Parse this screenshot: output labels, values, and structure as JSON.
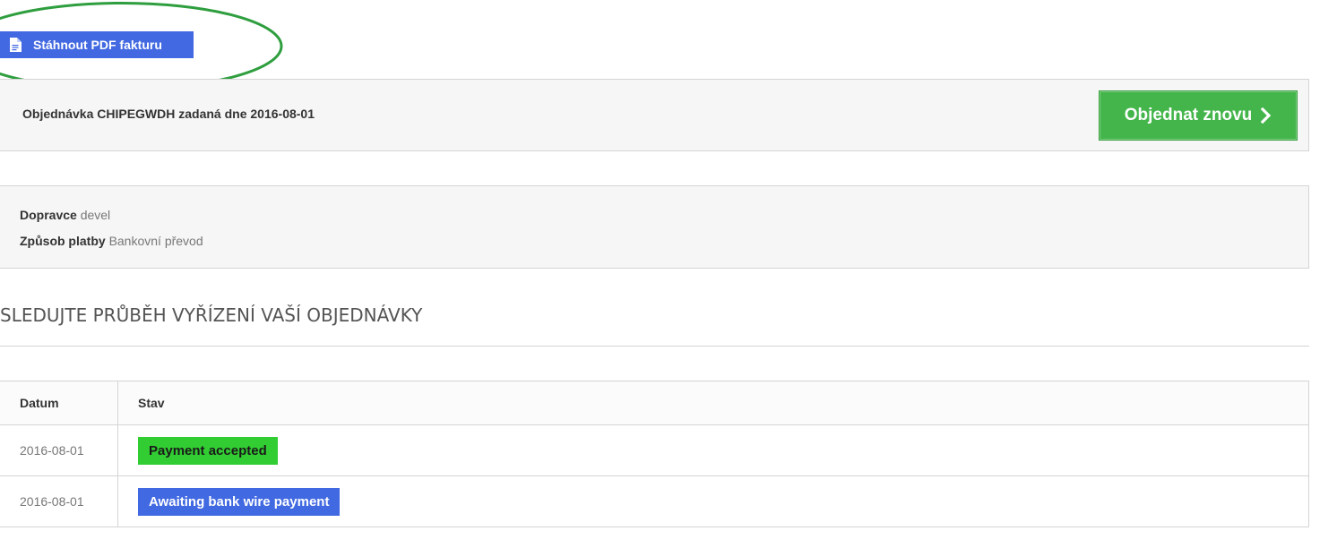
{
  "pdf_button": {
    "label": "Stáhnout PDF fakturu",
    "icon": "document-icon"
  },
  "order": {
    "title": "Objednávka CHIPEGWDH zadaná dne 2016-08-01",
    "reorder_label": "Objednat znovu",
    "reorder_icon": "chevron-right-icon"
  },
  "info": {
    "carrier_label": "Dopravce",
    "carrier_value": "devel",
    "payment_label": "Způsob platby",
    "payment_value": "Bankovní převod"
  },
  "tracking": {
    "heading": "Sledujte průběh vyřízení vaší objednávky",
    "columns": [
      "Datum",
      "Stav"
    ],
    "rows": [
      {
        "date": "2016-08-01",
        "status": "Payment accepted",
        "color": "#32cd32"
      },
      {
        "date": "2016-08-01",
        "status": "Awaiting bank wire payment",
        "color": "#4169e1"
      }
    ]
  },
  "colors": {
    "primary_blue": "#4269e1",
    "reorder_green": "#43b54a",
    "annotation_green": "#2e9e3e",
    "panel_bg": "#f6f6f6",
    "border": "#d6d4d4"
  }
}
